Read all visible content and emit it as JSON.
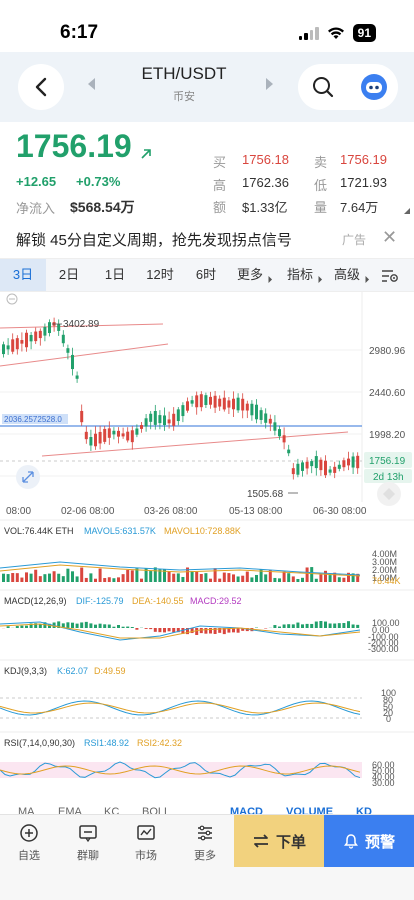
{
  "status": {
    "time": "6:17",
    "battery": "91"
  },
  "header": {
    "pair": "ETH/USDT",
    "exchange": "币安"
  },
  "price": {
    "last": "1756.19",
    "change_abs": "+12.65",
    "change_pct": "+0.73%",
    "inflow_label": "净流入",
    "inflow_value": "$568.54万",
    "quotes": [
      {
        "label": "买",
        "value": "1756.18",
        "red": true
      },
      {
        "label": "卖",
        "value": "1756.19",
        "red": true
      },
      {
        "label": "高",
        "value": "1762.36",
        "red": false
      },
      {
        "label": "低",
        "value": "1721.93",
        "red": false
      },
      {
        "label": "额",
        "value": "$1.33亿",
        "red": false
      },
      {
        "label": "量",
        "value": "7.64万",
        "red": false
      }
    ]
  },
  "ad": {
    "text": "解锁 45分自定义周期，抢先发现拐点信号",
    "tag": "广告"
  },
  "periods": [
    "3日",
    "2日",
    "1日",
    "12时",
    "6时"
  ],
  "more_tabs": [
    "更多",
    "指标",
    "高级"
  ],
  "chart": {
    "y_ticks": [
      "2980.96",
      "2440.60",
      "1998.20"
    ],
    "current_price": "1756.19",
    "countdown": "2d 13h",
    "high_label": "3402.89",
    "low_label": "1505.68",
    "line_label": "2036.2572528.0",
    "x_ticks": [
      "08:00",
      "02-06 08:00",
      "03-26 08:00",
      "05-13 08:00",
      "06-30 08:00"
    ],
    "vol": {
      "label": "VOL:76.44K ETH",
      "ma5": "MAVOL5:631.57K",
      "ma10": "MAVOL10:728.88K",
      "ticks": [
        "4.00M",
        "3.00M",
        "2.00M",
        "1.00M"
      ],
      "last": "76.44K"
    },
    "macd": {
      "label": "MACD(12,26,9)",
      "dif": "DIF:-125.79",
      "dea": "DEA:-140.55",
      "macd": "MACD:29.52",
      "ticks": [
        "100.00",
        "0.00",
        "-100.00",
        "-200.00",
        "-300.00"
      ]
    },
    "kdj": {
      "label": "KDJ(9,3,3)",
      "k": "K:62.07",
      "d": "D:49.59",
      "ticks": [
        "100",
        "80",
        "50",
        "20",
        "0"
      ]
    },
    "rsi": {
      "label": "RSI(7,14,0,90,30)",
      "rsi1": "RSI1:48.92",
      "rsi2": "RSI2:42.32",
      "ticks": [
        "60.00",
        "50.00",
        "40.00",
        "30.00"
      ]
    }
  },
  "indicator_tabs": [
    "MA",
    "EMA",
    "KC",
    "BOLL",
    "MACD",
    "VOLUME",
    "KD"
  ],
  "nav": {
    "items": [
      "自选",
      "群聊",
      "市场",
      "更多"
    ],
    "order": "下单",
    "alert": "预警"
  },
  "colors": {
    "up": "#21a06b",
    "down": "#d9463e",
    "accent": "#1a6fd6"
  }
}
